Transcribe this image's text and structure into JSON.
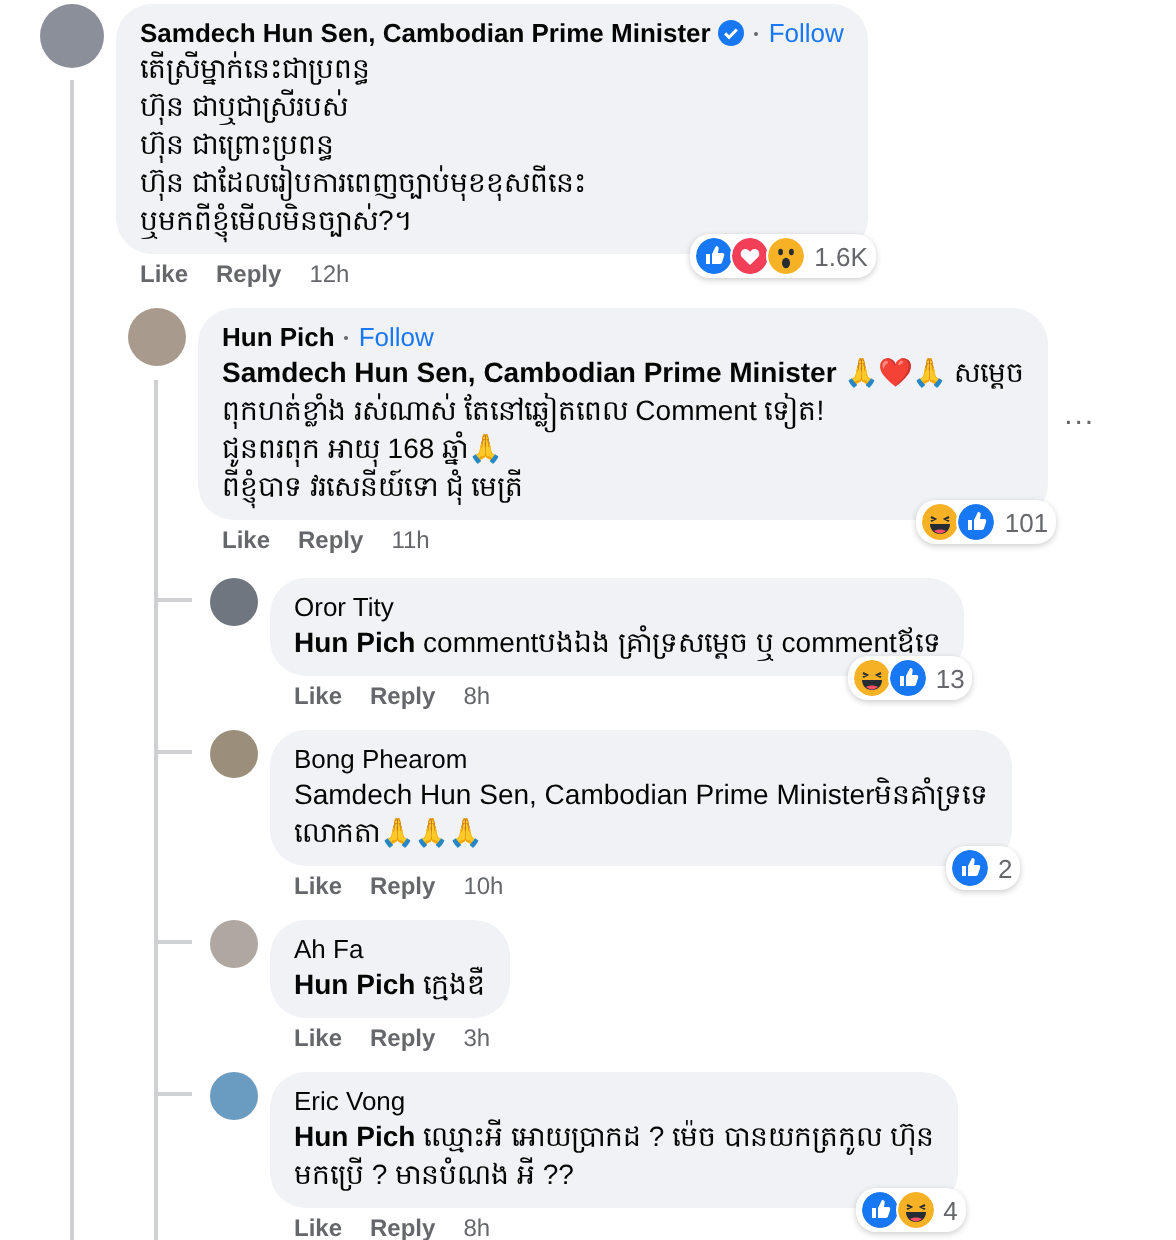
{
  "comments": [
    {
      "author": "Samdech Hun Sen, Cambodian Prime Minister",
      "verified": true,
      "follow": "Follow",
      "text": "តើស្រីម្នាក់នេះជាប្រពន្ធ\nហ៊ុន ជាឬជាស្រីរបស់\nហ៊ុន ជាព្រោះប្រពន្ធ\nហ៊ុន ជាដែលរៀបការពេញច្បាប់មុខខុសពីនេះ\nឬមកពីខ្ញុំមើលមិនច្បាស់?។",
      "reactions": [
        {
          "kind": "like"
        },
        {
          "kind": "love"
        },
        {
          "kind": "wow"
        }
      ],
      "reaction_count": "1.6K",
      "actions": [
        "Like",
        "Reply"
      ],
      "time": "12h",
      "replies": [
        {
          "author": "Hun Pich",
          "follow": "Follow",
          "menu": "...",
          "text": "**Samdech Hun Sen, Cambodian Prime Minister** 🙏❤️🙏 សម្ដេច\nពុកហត់ខ្លាំង រស់ណាស់ តែនៅឆ្លៀតពេល Comment ទៀត!\nជូនពរពុក អាយុ 168 ឆ្នាំ🙏\nពីខ្ញុំបាទ វរសេនីយ៍ទោ ជុំ មេត្រី",
          "reactions": [
            {
              "kind": "haha"
            },
            {
              "kind": "like"
            }
          ],
          "reaction_count": "101",
          "actions": [
            "Like",
            "Reply"
          ],
          "time": "11h",
          "replies": [
            {
              "author": "Oror Tity",
              "text": "**Hun Pich** commentបងឯង គ្រាំទ្រសម្ដេច ឬ commentឪទេ",
              "reactions": [
                {
                  "kind": "haha"
                },
                {
                  "kind": "like"
                }
              ],
              "reaction_count": "13",
              "actions": [
                "Like",
                "Reply"
              ],
              "time": "8h"
            },
            {
              "author": "Bong Phearom",
              "text": "Samdech Hun Sen, Cambodian Prime Ministerមិនគាំទ្រទេ\nលោកតា🙏🙏🙏",
              "reactions": [
                {
                  "kind": "like"
                }
              ],
              "reaction_count": "2",
              "actions": [
                "Like",
                "Reply"
              ],
              "time": "10h"
            },
            {
              "author": "Ah Fa",
              "text": "**Hun Pich** ក្មេងឌឺ",
              "actions": [
                "Like",
                "Reply"
              ],
              "time": "3h"
            },
            {
              "author": "Eric Vong",
              "text": "**Hun Pich** ឈ្មោះអី អោយប្រាកដ ? ម៉េច បានយកត្រកូល ហ៊ុន\nមកប្រើ ? មានបំណង អី ??",
              "reactions": [
                {
                  "kind": "like"
                },
                {
                  "kind": "haha"
                }
              ],
              "reaction_count": "4",
              "actions": [
                "Like",
                "Reply"
              ],
              "time": "8h"
            }
          ]
        }
      ]
    }
  ]
}
